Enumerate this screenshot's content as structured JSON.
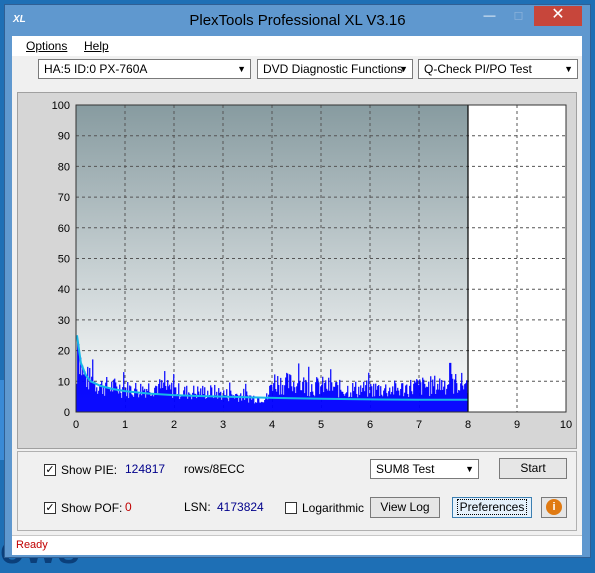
{
  "window": {
    "title": "PlexTools Professional XL V3.16",
    "app_icon": "XL"
  },
  "menu": {
    "options": "Options",
    "help": "Help"
  },
  "toolbar": {
    "drive": "HA:5 ID:0  PX-760A",
    "function": "DVD Diagnostic Functions",
    "test": "Q-Check PI/PO Test"
  },
  "chart_data": {
    "type": "bar",
    "x_ticks": [
      "0",
      "1",
      "2",
      "3",
      "4",
      "5",
      "6",
      "7",
      "8",
      "9",
      "10"
    ],
    "y_ticks": [
      "0",
      "10",
      "20",
      "30",
      "40",
      "50",
      "60",
      "70",
      "80",
      "90",
      "100"
    ],
    "xlim": [
      0,
      10
    ],
    "ylim": [
      0,
      100
    ],
    "grid": true,
    "scan_end_x": 8.0,
    "pie_bars": {
      "color": "#0000ff",
      "x": [
        0.02,
        0.05,
        0.1,
        0.15,
        0.2,
        0.3,
        0.4,
        0.5,
        0.7,
        1.0,
        1.3,
        1.6,
        1.9,
        2.2,
        2.5,
        2.8,
        3.1,
        3.4,
        3.6,
        3.8,
        3.9,
        4.0,
        4.2,
        4.5,
        4.8,
        5.1,
        5.4,
        5.7,
        6.0,
        6.3,
        6.6,
        6.9,
        7.2,
        7.5,
        7.8,
        7.95
      ],
      "y": [
        37,
        22,
        16,
        13,
        12,
        11,
        10,
        9,
        9,
        8,
        8,
        9,
        8,
        7,
        7,
        7,
        6,
        6,
        5,
        5,
        5,
        11,
        10,
        10,
        9,
        9,
        8,
        8,
        8,
        8,
        8,
        9,
        9,
        10,
        10,
        10
      ]
    },
    "pie_sum8_line": {
      "color": "#17b8e8",
      "x": [
        0.02,
        0.1,
        0.2,
        0.3,
        0.5,
        0.75,
        1.0,
        1.5,
        2.0,
        2.5,
        3.0,
        3.5,
        4.0,
        5.0,
        6.0,
        7.0,
        8.0
      ],
      "y": [
        25,
        16,
        12,
        10,
        8.5,
        7.5,
        6.8,
        6.0,
        5.5,
        5.2,
        5.0,
        4.8,
        4.6,
        4.3,
        4.1,
        4.0,
        4.0
      ]
    }
  },
  "stats": {
    "show_pie_label": "Show PIE:",
    "pie_value": "124817",
    "pie_unit": "rows/8ECC",
    "show_poe_label": "Show POF:",
    "poe_value": "0",
    "lsn_label": "LSN:",
    "lsn_value": "4173824",
    "logarithmic_label": "Logarithmic"
  },
  "controls": {
    "sum8_option": "SUM8 Test",
    "start": "Start",
    "view_log": "View Log",
    "preferences": "Preferences"
  },
  "status": {
    "text": "Ready"
  },
  "desktop": {
    "text": "ows"
  }
}
